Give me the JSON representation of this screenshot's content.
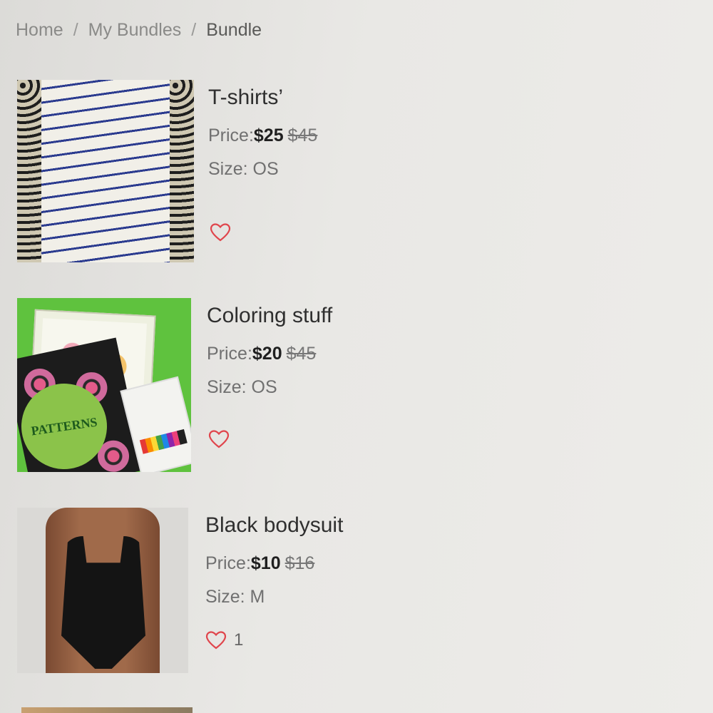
{
  "breadcrumb": {
    "items": [
      "Home",
      "My Bundles",
      "Bundle"
    ],
    "separator": "/"
  },
  "products": [
    {
      "title": "T-shirts’",
      "price_label": "Price:",
      "price": "$25",
      "original_price": "$45",
      "size_label": "Size: OS",
      "likes": "",
      "thumbnail": "striped-tshirt"
    },
    {
      "title": "Coloring stuff",
      "price_label": "Price:",
      "price": "$20",
      "original_price": "$45",
      "size_label": "Size: OS",
      "likes": "",
      "thumbnail": "coloring-books",
      "thumbnail_text": "PATTERNS"
    },
    {
      "title": "Black bodysuit",
      "price_label": "Price:",
      "price": "$10",
      "original_price": "$16",
      "size_label": "Size: M",
      "likes": "1",
      "thumbnail": "black-bodysuit"
    }
  ],
  "colors": {
    "heart": "#e0454c",
    "text_primary": "#2f2f2f",
    "text_muted": "#707070"
  },
  "icons": {
    "like": "heart-outline-icon"
  }
}
